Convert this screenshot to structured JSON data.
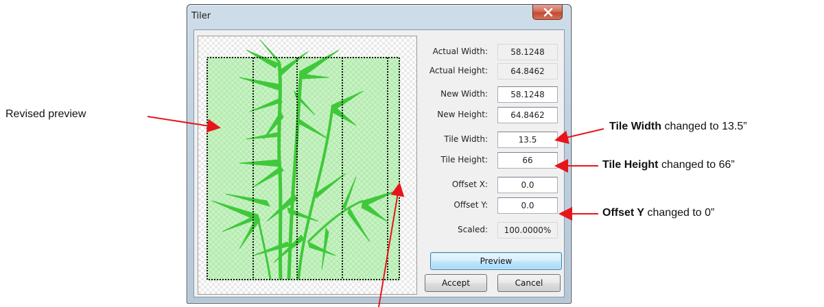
{
  "window": {
    "title": "Tiler",
    "close_glyph": "×"
  },
  "fields": [
    {
      "label": "Actual Width:",
      "value": "58.1248",
      "kind": "readonly"
    },
    {
      "label": "Actual Height:",
      "value": "64.8462",
      "kind": "readonly"
    },
    {
      "label": "New Width:",
      "value": "58.1248",
      "kind": "input"
    },
    {
      "label": "New Height:",
      "value": "64.8462",
      "kind": "input"
    },
    {
      "label": "Tile Width:",
      "value": "13.5",
      "kind": "input"
    },
    {
      "label": "Tile Height:",
      "value": "66",
      "kind": "input"
    },
    {
      "label": "Offset X:",
      "value": "0.0",
      "kind": "input"
    },
    {
      "label": "Offset Y:",
      "value": "0.0",
      "kind": "input"
    },
    {
      "label": "Scaled:",
      "value": "100.0000%",
      "kind": "readonly"
    }
  ],
  "buttons": {
    "preview": "Preview",
    "accept": "Accept",
    "cancel": "Cancel"
  },
  "annotations": {
    "revised_preview": "Revised preview",
    "tile_width_bold": "Tile Width",
    "tile_width_rest": " changed to 13.5”",
    "tile_height_bold": "Tile Height",
    "tile_height_rest": " changed to 66”",
    "offset_y_bold": "Offset Y",
    "offset_y_rest": " changed to 0”"
  },
  "colors": {
    "arrow": "#e8141a",
    "bamboo": "#3fc93a",
    "tile_line": "#111111"
  },
  "icons": {
    "close": "close-icon",
    "artwork": "bamboo-artwork"
  }
}
